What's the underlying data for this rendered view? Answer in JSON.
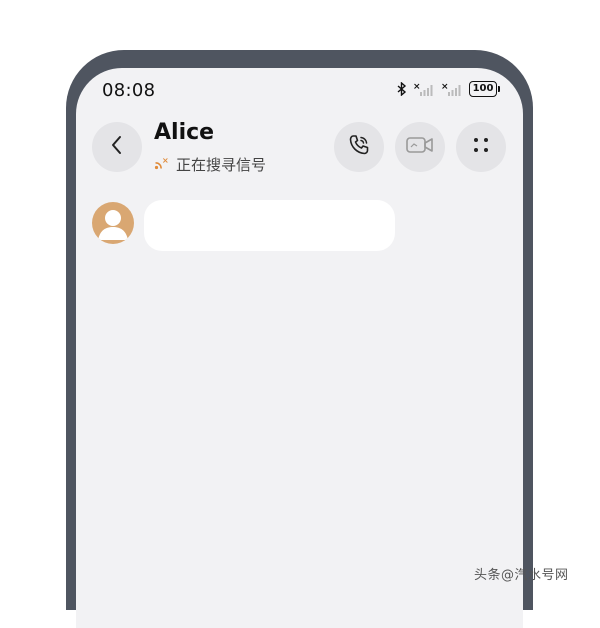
{
  "status_bar": {
    "time": "08:08",
    "battery": "100",
    "icons": [
      "bluetooth-icon",
      "signal-1-disconnected-icon",
      "signal-2-disconnected-icon",
      "battery-icon"
    ]
  },
  "header": {
    "back_icon": "chevron-left-icon",
    "contact_name": "Alice",
    "status_text": "正在搜寻信号",
    "status_icon": "searching-signal-icon",
    "status_color": "#e08b3a",
    "actions": [
      "voice-call-icon",
      "video-call-icon",
      "more-grid-icon"
    ]
  },
  "messages": [
    {
      "sender": "Alice",
      "avatar_color": "#d9a772",
      "text": ""
    }
  ],
  "watermark": "头条@汽水号网"
}
